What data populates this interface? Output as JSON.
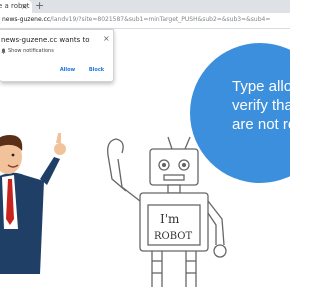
{
  "browser": {
    "tab_title": "e a robot",
    "tab_close": "×",
    "new_tab": "+",
    "url": {
      "host": "news-guzene.cc",
      "path": "/landv19/?site=8021587&sub1=minTarget_PUSH&sub2=&sub3=&sub4="
    }
  },
  "notification": {
    "title": "news-guzene.cc wants to",
    "close": "×",
    "icon": "bell-icon",
    "description": "Show notifications",
    "allow_label": "Allow",
    "block_label": "Block"
  },
  "page": {
    "bubble_lines": [
      "Type allow",
      "verify that",
      "are not rob"
    ],
    "robot_sign": [
      "I'm",
      "ROBOT"
    ]
  },
  "colors": {
    "bubble": "#3b8fdc",
    "button_text": "#1a73e8"
  }
}
